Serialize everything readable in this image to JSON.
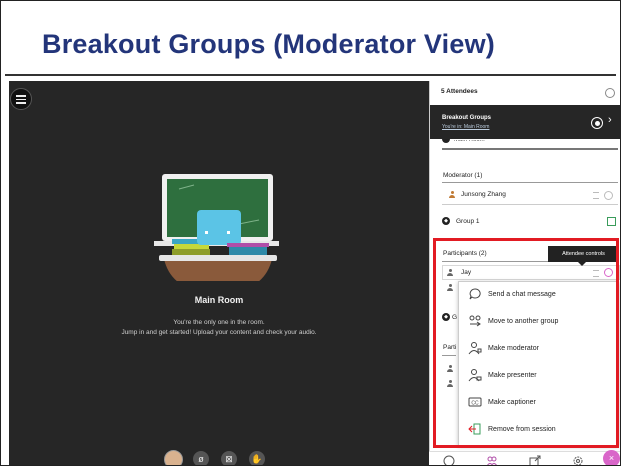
{
  "slide": {
    "title": "Breakout Groups (Moderator View)"
  },
  "stage": {
    "room_title": "Main Room",
    "message_line1": "You're the only one in the room.",
    "message_line2": "Jump in and get started! Upload your content and check your audio."
  },
  "panel": {
    "attendees_header": "5 Attendees",
    "breakout_title": "Breakout Groups",
    "breakout_subtitle": "You're in: Main Room",
    "partial_row": "Main Room",
    "moderator_label": "Moderator (1)",
    "moderator_name": "Junsong Zhang",
    "group1_label": "Group 1",
    "participants_label": "Participants (2)",
    "participant_name": "Jay",
    "group_partial": "G",
    "participants_partial": "Parti",
    "tooltip": "Attendee controls"
  },
  "menu": {
    "items": [
      {
        "label": "Send a chat message",
        "icon": "chat-bubble-icon"
      },
      {
        "label": "Move to another group",
        "icon": "move-group-icon"
      },
      {
        "label": "Make moderator",
        "icon": "moderator-icon"
      },
      {
        "label": "Make presenter",
        "icon": "presenter-icon"
      },
      {
        "label": "Make captioner",
        "icon": "cc-icon"
      },
      {
        "label": "Remove from session",
        "icon": "remove-icon"
      }
    ]
  },
  "colors": {
    "title": "#23357a",
    "highlight": "#e21b23",
    "stage_bg": "#262626",
    "accent_pink": "#d966c9"
  }
}
